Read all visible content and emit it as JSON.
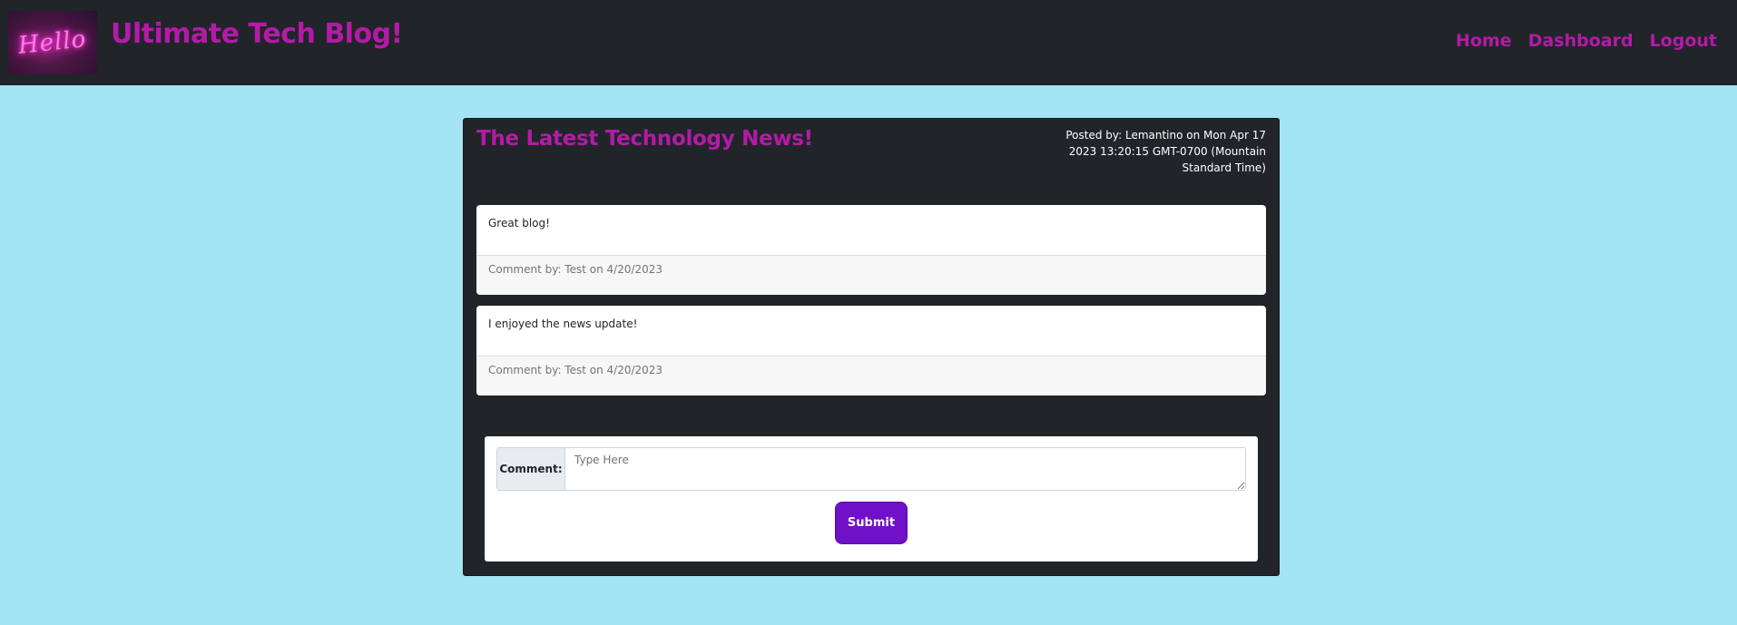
{
  "header": {
    "logo_text": "Hello",
    "brand": "Ultimate Tech Blog!",
    "nav": [
      {
        "label": "Home"
      },
      {
        "label": "Dashboard"
      },
      {
        "label": "Logout"
      }
    ]
  },
  "post": {
    "title": "The Latest Technology News!",
    "meta": "Posted by: Lemantino on Mon Apr 17 2023 13:20:15 GMT-0700 (Mountain Standard Time)"
  },
  "comments": [
    {
      "body": "Great blog!",
      "footer": "Comment by: Test on 4/20/2023"
    },
    {
      "body": "I enjoyed the news update!",
      "footer": "Comment by: Test on 4/20/2023"
    }
  ],
  "form": {
    "label": "Comment:",
    "placeholder": "Type Here",
    "value": "",
    "submit_label": "Submit"
  },
  "colors": {
    "page_background": "#a3e4f5",
    "navbar": "#212529",
    "accent_magenta": "#b41aa8",
    "submit_purple": "#7010c8"
  }
}
